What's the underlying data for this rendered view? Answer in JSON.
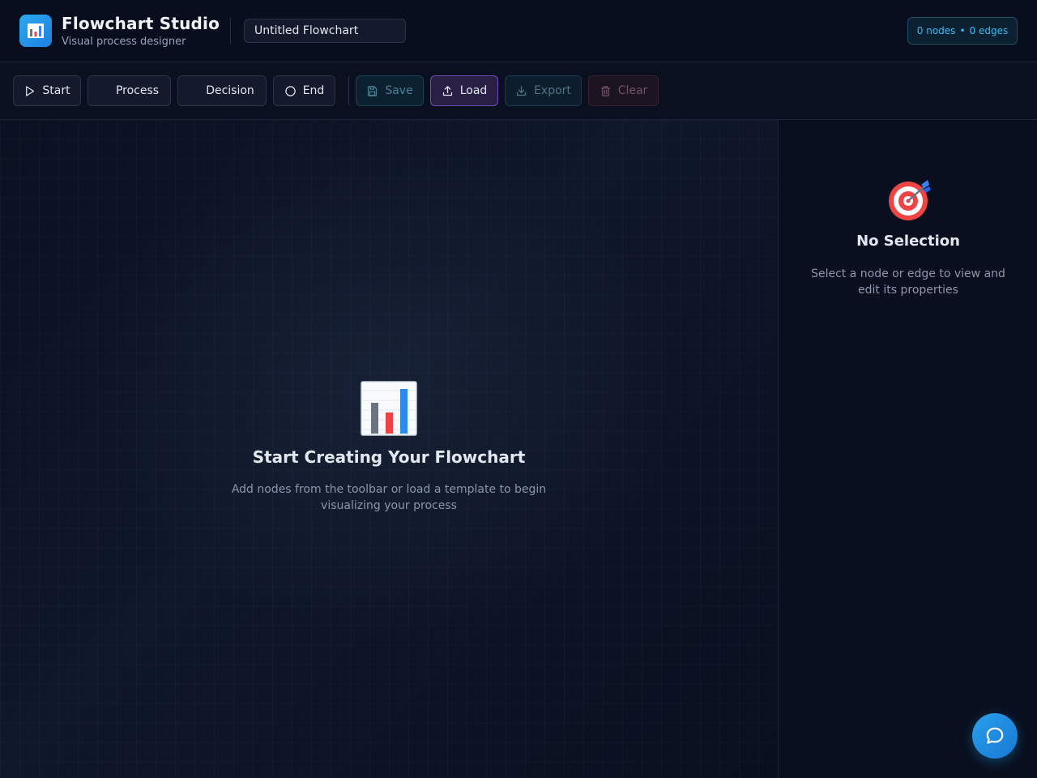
{
  "header": {
    "app_title": "Flowchart Studio",
    "app_subtitle": "Visual process designer",
    "logo_icon": "bar-chart-icon",
    "flowchart_name": "Untitled Flowchart",
    "stats": {
      "nodes": "0 nodes",
      "separator": "•",
      "edges": "0 edges"
    }
  },
  "toolbar": {
    "node_buttons": {
      "start": {
        "label": "Start",
        "icon": "play-icon"
      },
      "process": {
        "label": "Process"
      },
      "decision": {
        "label": "Decision"
      },
      "end": {
        "label": "End",
        "icon": "circle-icon"
      }
    },
    "action_buttons": {
      "save": {
        "label": "Save",
        "icon": "save-icon"
      },
      "load": {
        "label": "Load",
        "icon": "upload-icon"
      },
      "export": {
        "label": "Export",
        "icon": "download-icon"
      },
      "clear": {
        "label": "Clear",
        "icon": "trash-icon"
      }
    }
  },
  "canvas": {
    "empty_state": {
      "icon": "bar-chart-emoji-icon",
      "title": "Start Creating Your Flowchart",
      "description": "Add nodes from the toolbar or load a template to begin visualizing your process"
    }
  },
  "properties_panel": {
    "icon": "target-icon",
    "title": "No Selection",
    "description": "Select a node or edge to view and edit its properties"
  },
  "chat_button": {
    "icon": "chat-bubble-icon"
  },
  "colors": {
    "background": "#0a0f1f",
    "accent": "#1e90e8",
    "load_accent": "#6d4fb8",
    "stats_text": "#38bdf8"
  }
}
